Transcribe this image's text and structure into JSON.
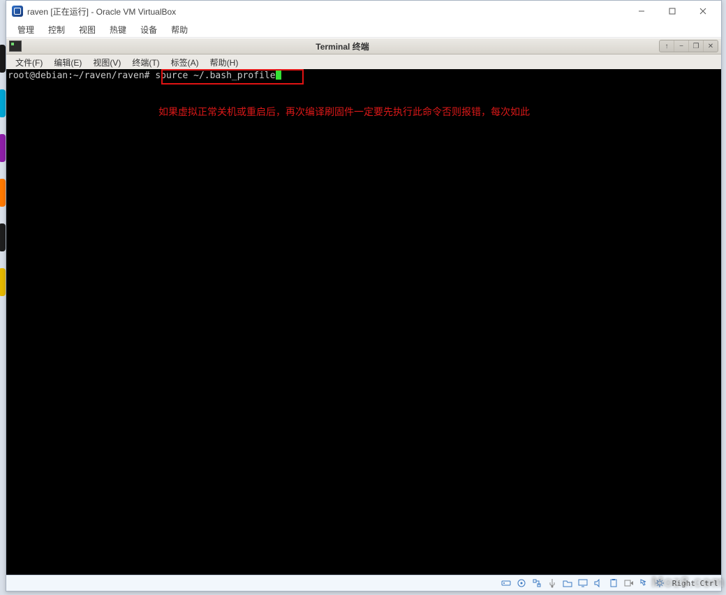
{
  "host_window": {
    "title": "raven [正在运行] - Oracle VM VirtualBox",
    "menu": [
      "管理",
      "控制",
      "视图",
      "热键",
      "设备",
      "帮助"
    ]
  },
  "guest_terminal": {
    "title": "Terminal 终端",
    "menu": [
      "文件(F)",
      "编辑(E)",
      "视图(V)",
      "终端(T)",
      "标签(A)",
      "帮助(H)"
    ],
    "window_buttons": {
      "up": "↑",
      "min": "−",
      "max": "❐",
      "close": "✕"
    }
  },
  "shell": {
    "prompt": "root@debian:~/raven/raven# ",
    "command": "source ~/.bash_profile"
  },
  "annotation_text": "如果虚拟正常关机或重启后，再次编译刷固件一定要先执行此命令否则报错，每次如此",
  "status_bar": {
    "right_ctrl": "Right Ctrl",
    "icons": [
      "hdd-icon",
      "optical-icon",
      "network-icon",
      "usb-icon",
      "shared-folder-icon",
      "display-icon",
      "audio-icon",
      "clipboard-icon",
      "record-icon",
      "mouse-icon",
      "settings-icon"
    ]
  },
  "watermark": "Moz8.com"
}
